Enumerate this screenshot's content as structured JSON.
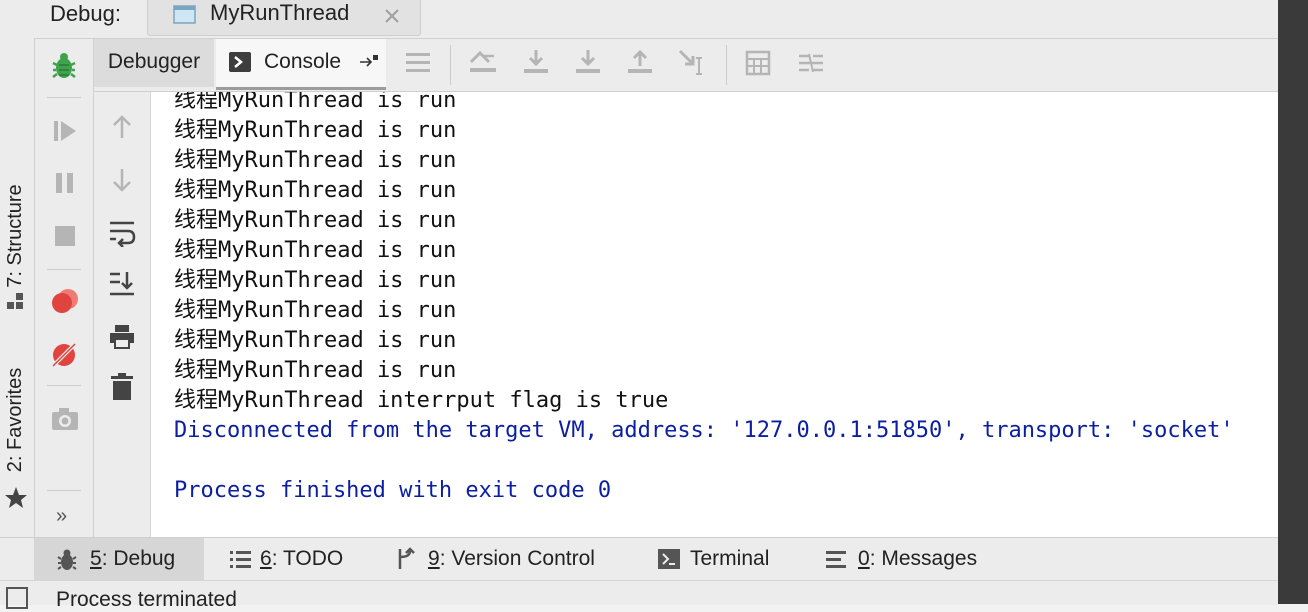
{
  "title_bar": {
    "debug_label": "Debug:",
    "run_config_tab": "MyRunThread",
    "close_icon": "close-icon"
  },
  "left_stripe": {
    "items": [
      {
        "label": "7: Structure",
        "icon": "structure-icon"
      },
      {
        "label": "2: Favorites",
        "icon": "star-icon"
      }
    ]
  },
  "debug_toolbar": {
    "icons": [
      "bug-icon",
      "resume-icon",
      "pause-icon",
      "stop-icon",
      "view-breakpoints-icon",
      "mute-breakpoints-icon",
      "camera-icon",
      "more-icon"
    ],
    "more_label": "»"
  },
  "top_toolbar": {
    "tabs": [
      {
        "label": "Debugger",
        "active": false
      },
      {
        "label": "Console",
        "active": true
      }
    ],
    "icons": [
      "restore-layout-icon",
      "show-execution-point-icon",
      "step-over-icon",
      "step-into-icon",
      "force-step-into-icon",
      "step-out-icon",
      "run-to-cursor-icon",
      "evaluate-expression-icon",
      "trace-icon"
    ]
  },
  "console_side_toolbar": {
    "icons": [
      "up-arrow-icon",
      "down-arrow-icon",
      "soft-wrap-icon",
      "scroll-to-end-icon",
      "print-icon",
      "trash-icon"
    ]
  },
  "console": {
    "lines": [
      {
        "text": "线程MyRunThread is run",
        "type": "out"
      },
      {
        "text": "线程MyRunThread is run",
        "type": "out"
      },
      {
        "text": "线程MyRunThread is run",
        "type": "out"
      },
      {
        "text": "线程MyRunThread is run",
        "type": "out"
      },
      {
        "text": "线程MyRunThread is run",
        "type": "out"
      },
      {
        "text": "线程MyRunThread is run",
        "type": "out"
      },
      {
        "text": "线程MyRunThread is run",
        "type": "out"
      },
      {
        "text": "线程MyRunThread is run",
        "type": "out"
      },
      {
        "text": "线程MyRunThread is run",
        "type": "out"
      },
      {
        "text": "线程MyRunThread is run",
        "type": "out"
      },
      {
        "text": "线程MyRunThread interrput flag is true",
        "type": "out"
      },
      {
        "text": "Disconnected from the target VM, address: '127.0.0.1:51850', transport: 'socket'",
        "type": "sys"
      },
      {
        "text": "",
        "type": "blank"
      },
      {
        "text": "Process finished with exit code 0",
        "type": "sys"
      }
    ]
  },
  "bottom_bar": {
    "tabs": [
      {
        "num": "5",
        "label": ": Debug",
        "icon": "bug-icon",
        "active": true
      },
      {
        "num": "6",
        "label": ": TODO",
        "icon": "list-icon",
        "active": false
      },
      {
        "num": "9",
        "label": ": Version Control",
        "icon": "vcs-icon",
        "active": false
      },
      {
        "num": "",
        "label": "Terminal",
        "icon": "terminal-icon",
        "active": false
      },
      {
        "num": "0",
        "label": ": Messages",
        "icon": "messages-icon",
        "active": false
      }
    ]
  },
  "status_bar": {
    "text": "Process terminated"
  },
  "colors": {
    "system_text": "#0b1fa0",
    "output_text": "#111111",
    "bug_green": "#3fa34d",
    "breakpoint_red": "#e0443e"
  }
}
